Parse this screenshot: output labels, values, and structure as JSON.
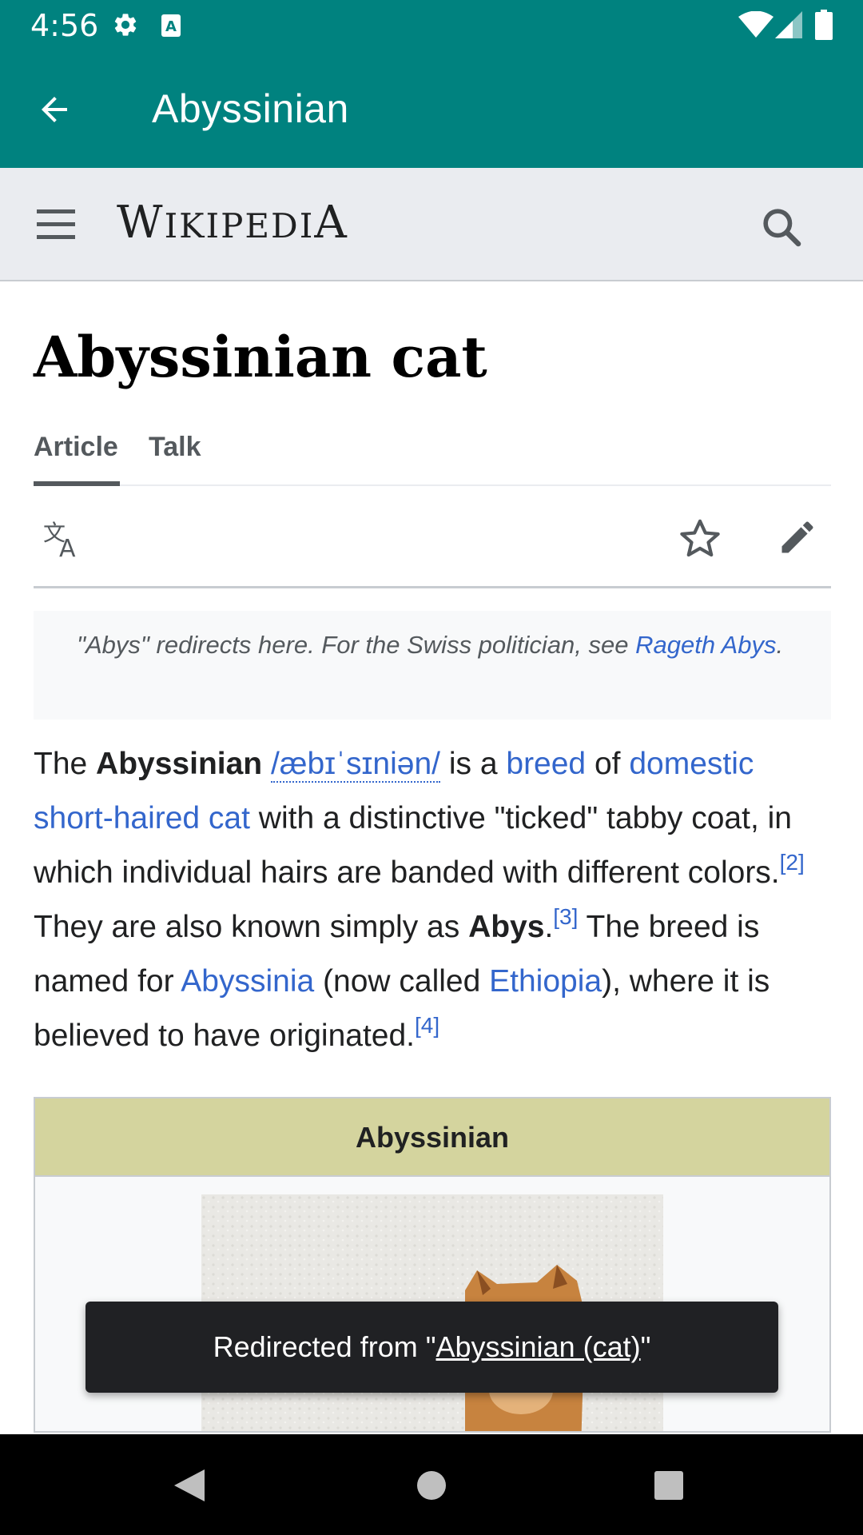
{
  "status_bar": {
    "time": "4:56",
    "icons": [
      "gear-icon",
      "keyboard-a-icon",
      "wifi-icon",
      "signal-icon",
      "battery-icon"
    ]
  },
  "app_bar": {
    "title": "Abyssinian",
    "back_icon": "arrow-left-icon",
    "color": "#00827f"
  },
  "wiki_header": {
    "wordmark_first": "W",
    "wordmark_mid": "IKIPEDI",
    "wordmark_last": "A",
    "menu_icon": "hamburger-icon",
    "search_icon": "search-icon"
  },
  "page": {
    "title": "Abyssinian cat",
    "tabs": [
      {
        "label": "Article",
        "selected": true
      },
      {
        "label": "Talk",
        "selected": false
      }
    ]
  },
  "actions": {
    "icons": [
      "language-icon",
      "star-icon",
      "edit-pencil-icon"
    ]
  },
  "hatnote": {
    "text": "\"Abys\" redirects here. For the Swiss politician, see ",
    "link": "Rageth Abys",
    "end": "."
  },
  "lead": {
    "t1": "The ",
    "b1": "Abyssinian",
    "ipa": "/æbɪˈsɪniən/",
    "t2": " is a ",
    "l_breed": "breed",
    "t3": " of ",
    "l_domestic": "domestic short-haired cat",
    "t4": " with a distinctive \"ticked\" tabby coat, in which individual hairs are banded with different colors.",
    "ref2": "[2]",
    "t5": " They are also known simply as ",
    "b2": "Abys",
    "t6": ".",
    "ref3": "[3]",
    "t7": " The breed is named for ",
    "l_abyssinia": "Abyssinia",
    "t8": " (now called ",
    "l_ethiopia": "Ethiopia",
    "t9": "), where it is believed to have originated.",
    "ref4": "[4]"
  },
  "infobox": {
    "title": "Abyssinian",
    "header_color": "#d4d49e"
  },
  "snackbar": {
    "prefix": "Redirected from \"",
    "link": "Abyssinian (cat)",
    "suffix": "\""
  },
  "nav_bar": {
    "icons": [
      "back-triangle-icon",
      "home-circle-icon",
      "recents-square-icon"
    ]
  }
}
